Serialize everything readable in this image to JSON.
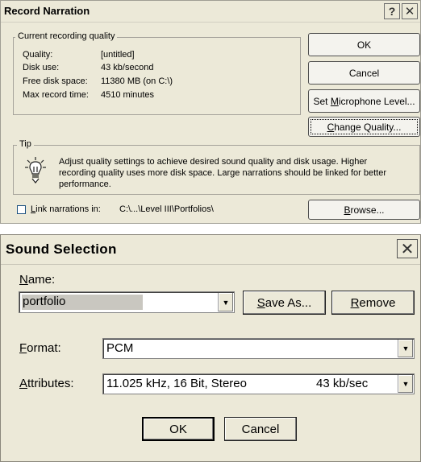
{
  "record_narration": {
    "title": "Record Narration",
    "help_glyph": "?",
    "close_glyph": "✕",
    "quality_group": {
      "legend": "Current recording quality",
      "rows": [
        {
          "label": "Quality:",
          "value": "[untitled]"
        },
        {
          "label": "Disk use:",
          "value": "43 kb/second"
        },
        {
          "label": "Free disk space:",
          "value": "11380 MB (on C:\\)"
        },
        {
          "label": "Max record time:",
          "value": "4510 minutes"
        }
      ]
    },
    "buttons": {
      "ok": "OK",
      "cancel": "Cancel",
      "set_mic_pre": "Set ",
      "set_mic_key": "M",
      "set_mic_post": "icrophone Level...",
      "change_quality_key": "C",
      "change_quality_post": "hange Quality...",
      "browse_key": "B",
      "browse_post": "rowse..."
    },
    "tip": {
      "legend": "Tip",
      "icon": "lightbulb-icon",
      "text_line1": "Adjust quality settings to achieve desired sound quality and disk usage. Higher",
      "text_line2": "recording quality uses more disk space. Large narrations should be linked for better",
      "text_line3": "performance."
    },
    "link": {
      "checked": false,
      "label_key": "L",
      "label_post": "ink narrations in:",
      "path": "C:\\...\\Level III\\Portfolios\\"
    }
  },
  "sound_selection": {
    "title": "Sound Selection",
    "close_glyph": "✕",
    "name": {
      "label_key": "N",
      "label_post": "ame:",
      "value": "portfolio"
    },
    "save_as_key": "S",
    "save_as_post": "ave As...",
    "remove_key": "R",
    "remove_post": "emove",
    "format": {
      "label_key": "F",
      "label_post": "ormat:",
      "value": "PCM"
    },
    "attributes": {
      "label_key": "A",
      "label_post": "ttributes:",
      "value": "11.025 kHz, 16 Bit, Stereo",
      "rate": "43 kb/sec"
    },
    "ok": "OK",
    "cancel": "Cancel",
    "arrow_glyph": "▼"
  }
}
